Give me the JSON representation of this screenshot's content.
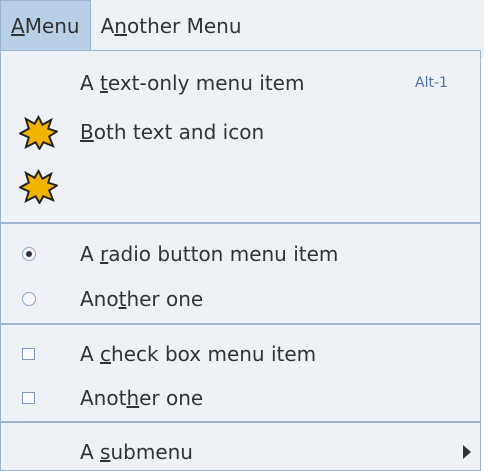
{
  "menubar": {
    "menus": [
      {
        "label_underlined": "A",
        "label_rest": " Menu"
      },
      {
        "label_underlined": "n",
        "label_prefix": "A",
        "label_rest": "other Menu"
      }
    ]
  },
  "popup": {
    "text_item": {
      "label_prefix": "A ",
      "label_underlined": "t",
      "label_rest": "ext-only menu item",
      "accelerator": "Alt-1"
    },
    "both_item": {
      "label_prefix": "",
      "label_underlined": "B",
      "label_rest": "oth text and icon"
    },
    "icon_item": {
      "icon": "starburst-icon"
    },
    "radio_items": [
      {
        "label_prefix": "A ",
        "label_underlined": "r",
        "label_rest": "adio button menu item",
        "selected": true
      },
      {
        "label_prefix": "Ano",
        "label_underlined": "t",
        "label_rest": "her one",
        "selected": false
      }
    ],
    "check_items": [
      {
        "label_prefix": "A ",
        "label_underlined": "c",
        "label_rest": "heck box menu item",
        "checked": false
      },
      {
        "label_prefix": "Anot",
        "label_underlined": "h",
        "label_rest": "er one",
        "checked": false
      }
    ],
    "submenu": {
      "label_prefix": "A ",
      "label_underlined": "s",
      "label_rest": "ubmenu"
    }
  },
  "colors": {
    "menubar_bg": "#eef2f6",
    "selected_menu_bg": "#b8cfe5",
    "accelerator": "#5170b0",
    "separator": "#9fb3cf"
  }
}
